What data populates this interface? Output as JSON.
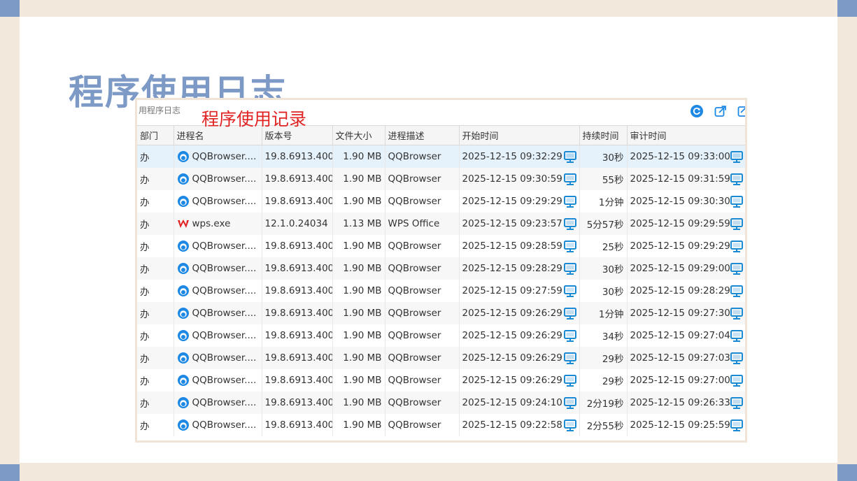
{
  "slide_title": "程序使用日志",
  "crumb": "用程序日志",
  "annotation": "程序使用记录",
  "columns": [
    "部门",
    "进程名",
    "版本号",
    "文件大小",
    "进程描述",
    "开始时间",
    "持续时间",
    "审计时间"
  ],
  "rows": [
    {
      "dept": "办",
      "icon": "qqbrowser",
      "process": "QQBrowser....",
      "version": "19.8.6913.400",
      "size": "1.90 MB",
      "desc": "QQBrowser",
      "start": "2025-12-15 09:32:29",
      "duration": "30秒",
      "audit": "2025-12-15 09:33:00"
    },
    {
      "dept": "办",
      "icon": "qqbrowser",
      "process": "QQBrowser....",
      "version": "19.8.6913.400",
      "size": "1.90 MB",
      "desc": "QQBrowser",
      "start": "2025-12-15 09:30:59",
      "duration": "55秒",
      "audit": "2025-12-15 09:31:59"
    },
    {
      "dept": "办",
      "icon": "qqbrowser",
      "process": "QQBrowser....",
      "version": "19.8.6913.400",
      "size": "1.90 MB",
      "desc": "QQBrowser",
      "start": "2025-12-15 09:29:29",
      "duration": "1分钟",
      "audit": "2025-12-15 09:30:30"
    },
    {
      "dept": "办",
      "icon": "wps",
      "process": "wps.exe",
      "version": "12.1.0.24034",
      "size": "1.13 MB",
      "desc": "WPS Office",
      "start": "2025-12-15 09:23:57",
      "duration": "5分57秒",
      "audit": "2025-12-15 09:29:59"
    },
    {
      "dept": "办",
      "icon": "qqbrowser",
      "process": "QQBrowser....",
      "version": "19.8.6913.400",
      "size": "1.90 MB",
      "desc": "QQBrowser",
      "start": "2025-12-15 09:28:59",
      "duration": "25秒",
      "audit": "2025-12-15 09:29:29"
    },
    {
      "dept": "办",
      "icon": "qqbrowser",
      "process": "QQBrowser....",
      "version": "19.8.6913.400",
      "size": "1.90 MB",
      "desc": "QQBrowser",
      "start": "2025-12-15 09:28:29",
      "duration": "30秒",
      "audit": "2025-12-15 09:29:00"
    },
    {
      "dept": "办",
      "icon": "qqbrowser",
      "process": "QQBrowser....",
      "version": "19.8.6913.400",
      "size": "1.90 MB",
      "desc": "QQBrowser",
      "start": "2025-12-15 09:27:59",
      "duration": "30秒",
      "audit": "2025-12-15 09:28:29"
    },
    {
      "dept": "办",
      "icon": "qqbrowser",
      "process": "QQBrowser....",
      "version": "19.8.6913.400",
      "size": "1.90 MB",
      "desc": "QQBrowser",
      "start": "2025-12-15 09:26:29",
      "duration": "1分钟",
      "audit": "2025-12-15 09:27:30"
    },
    {
      "dept": "办",
      "icon": "qqbrowser",
      "process": "QQBrowser....",
      "version": "19.8.6913.400",
      "size": "1.90 MB",
      "desc": "QQBrowser",
      "start": "2025-12-15 09:26:29",
      "duration": "34秒",
      "audit": "2025-12-15 09:27:04"
    },
    {
      "dept": "办",
      "icon": "qqbrowser",
      "process": "QQBrowser....",
      "version": "19.8.6913.400",
      "size": "1.90 MB",
      "desc": "QQBrowser",
      "start": "2025-12-15 09:26:29",
      "duration": "29秒",
      "audit": "2025-12-15 09:27:03"
    },
    {
      "dept": "办",
      "icon": "qqbrowser",
      "process": "QQBrowser....",
      "version": "19.8.6913.400",
      "size": "1.90 MB",
      "desc": "QQBrowser",
      "start": "2025-12-15 09:26:29",
      "duration": "29秒",
      "audit": "2025-12-15 09:27:00"
    },
    {
      "dept": "办",
      "icon": "qqbrowser",
      "process": "QQBrowser....",
      "version": "19.8.6913.400",
      "size": "1.90 MB",
      "desc": "QQBrowser",
      "start": "2025-12-15 09:24:10",
      "duration": "2分19秒",
      "audit": "2025-12-15 09:26:33"
    },
    {
      "dept": "办",
      "icon": "qqbrowser",
      "process": "QQBrowser....",
      "version": "19.8.6913.400",
      "size": "1.90 MB",
      "desc": "QQBrowser",
      "start": "2025-12-15 09:22:58",
      "duration": "2分55秒",
      "audit": "2025-12-15 09:25:59"
    }
  ],
  "selected_row": 0,
  "colors": {
    "accent": "#7d9ac6",
    "frame": "#f3e8dc",
    "annotation": "#e02424",
    "monitor": "#1a8ad4",
    "wps": "#e02424",
    "qq": "#1e88e5"
  },
  "toolbar": {
    "refresh_icon": "refresh-icon",
    "export_icon": "export-icon",
    "extra_icon": "open-external-icon"
  }
}
